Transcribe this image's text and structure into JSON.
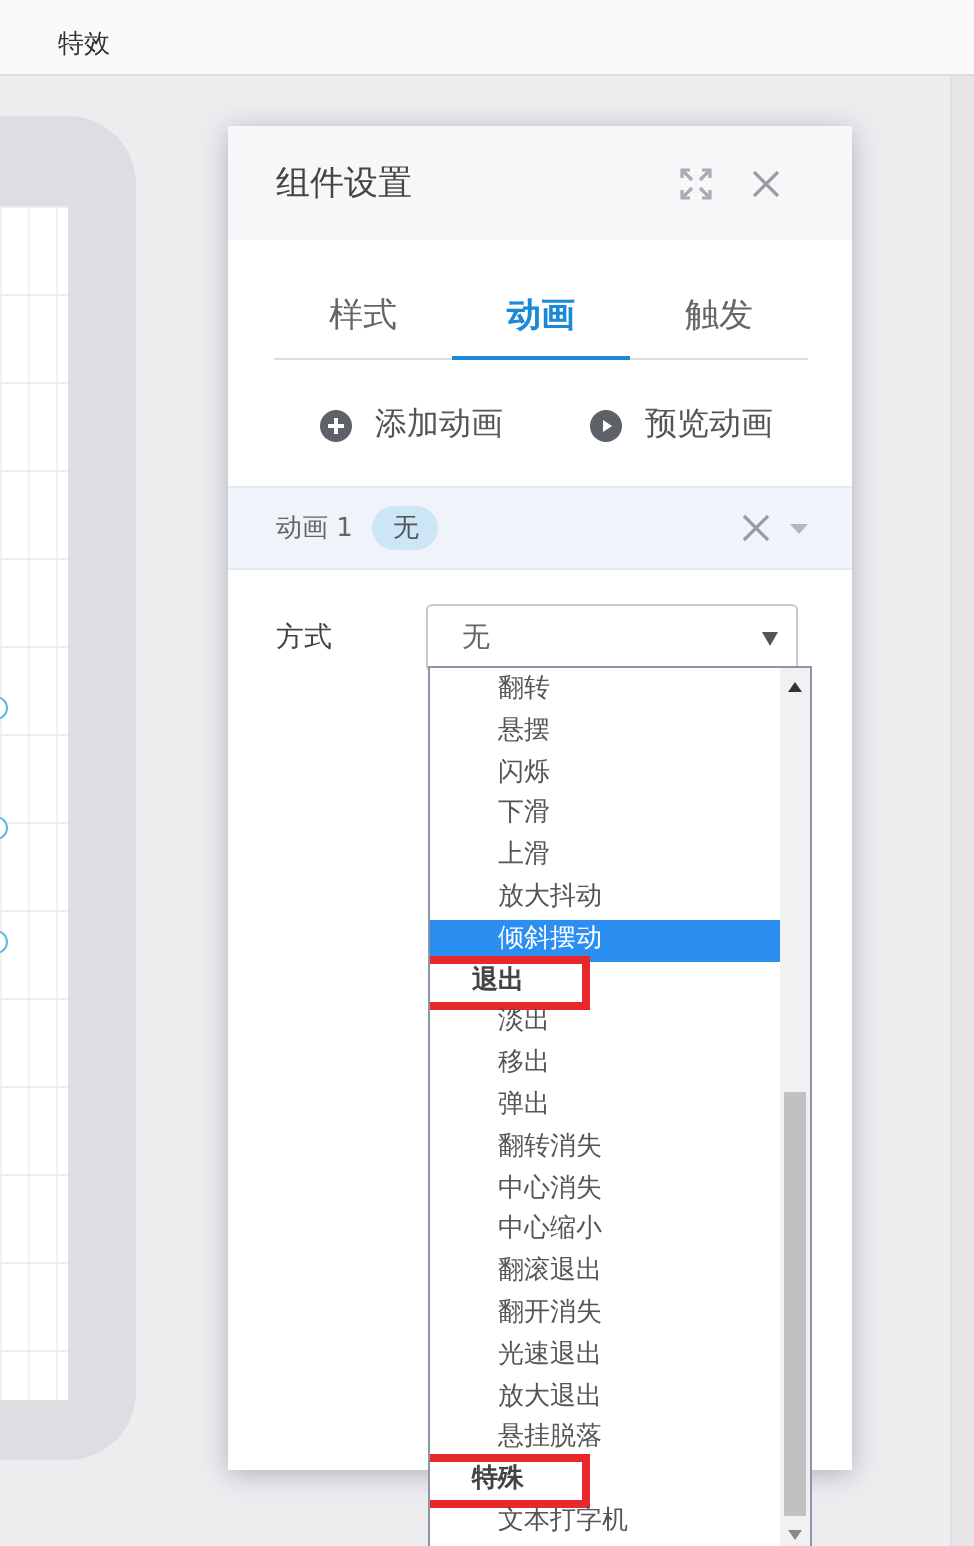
{
  "top_bar": {
    "menu_label": "特效"
  },
  "dialog": {
    "title": "组件设置",
    "tabs": [
      {
        "label": "样式",
        "selected": false
      },
      {
        "label": "动画",
        "selected": true
      },
      {
        "label": "触发",
        "selected": false
      }
    ],
    "actions": [
      {
        "kind": "add",
        "label": "添加动画"
      },
      {
        "kind": "play",
        "label": "预览动画"
      }
    ],
    "animation": {
      "label": "动画 1",
      "tag": "无"
    },
    "field": {
      "label": "方式",
      "value": "无"
    },
    "options": [
      {
        "kind": "option",
        "label": "翻转",
        "selected": false,
        "annotated": false
      },
      {
        "kind": "option",
        "label": "悬摆",
        "selected": false,
        "annotated": false
      },
      {
        "kind": "option",
        "label": "闪烁",
        "selected": false,
        "annotated": false
      },
      {
        "kind": "option",
        "label": "下滑",
        "selected": false,
        "annotated": false
      },
      {
        "kind": "option",
        "label": "上滑",
        "selected": false,
        "annotated": false
      },
      {
        "kind": "option",
        "label": "放大抖动",
        "selected": false,
        "annotated": false
      },
      {
        "kind": "option",
        "label": "倾斜摆动",
        "selected": true,
        "annotated": false
      },
      {
        "kind": "group",
        "label": "退出",
        "selected": false,
        "annotated": true
      },
      {
        "kind": "option",
        "label": "淡出",
        "selected": false,
        "annotated": false
      },
      {
        "kind": "option",
        "label": "移出",
        "selected": false,
        "annotated": false
      },
      {
        "kind": "option",
        "label": "弹出",
        "selected": false,
        "annotated": false
      },
      {
        "kind": "option",
        "label": "翻转消失",
        "selected": false,
        "annotated": false
      },
      {
        "kind": "option",
        "label": "中心消失",
        "selected": false,
        "annotated": false
      },
      {
        "kind": "option",
        "label": "中心缩小",
        "selected": false,
        "annotated": false
      },
      {
        "kind": "option",
        "label": "翻滚退出",
        "selected": false,
        "annotated": false
      },
      {
        "kind": "option",
        "label": "翻开消失",
        "selected": false,
        "annotated": false
      },
      {
        "kind": "option",
        "label": "光速退出",
        "selected": false,
        "annotated": false
      },
      {
        "kind": "option",
        "label": "放大退出",
        "selected": false,
        "annotated": false
      },
      {
        "kind": "option",
        "label": "悬挂脱落",
        "selected": false,
        "annotated": false
      },
      {
        "kind": "group",
        "label": "特殊",
        "selected": false,
        "annotated": true
      },
      {
        "kind": "option",
        "label": "文本打字机",
        "selected": false,
        "annotated": false
      }
    ]
  }
}
